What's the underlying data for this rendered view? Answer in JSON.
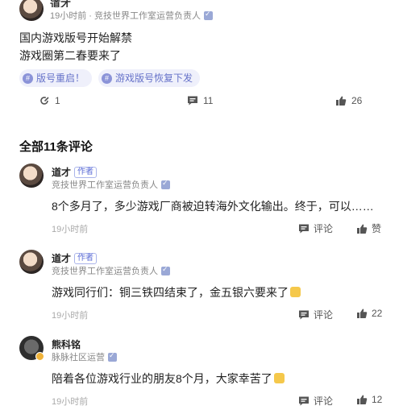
{
  "post": {
    "author": "道才",
    "meta": "19小时前 · 竞技世界工作室运营负责人",
    "lines": [
      "国内游戏版号开始解禁",
      "游戏圈第二春要来了"
    ],
    "tags": [
      "版号重启！",
      "游戏版号恢复下发"
    ],
    "actions": {
      "repost": "1",
      "comments": "11",
      "likes": "26"
    }
  },
  "comments_section": {
    "title": "全部11条评论",
    "comments": [
      {
        "name": "道才",
        "author_tag": "作者",
        "role": "竞技世界工作室运营负责人",
        "text": "8个多月了，多少游戏厂商被迫转海外文化输出。终于，可以……",
        "time": "19小时前",
        "reply": "评论",
        "like": "赞"
      },
      {
        "name": "道才",
        "author_tag": "作者",
        "role": "竞技世界工作室运营负责人",
        "text": "游戏同行们：铜三铁四结束了，金五银六要来了",
        "time": "19小时前",
        "reply": "评论",
        "like": "22"
      },
      {
        "name": "熊科铭",
        "author_tag": "",
        "role": "脉脉社区运营",
        "text": "陪着各位游戏行业的朋友8个月，大家幸苦了",
        "time": "19小时前",
        "reply": "评论",
        "like": "12"
      }
    ]
  },
  "colors": {
    "accent": "#5a6bd6",
    "tag_bg": "#eff0fb"
  }
}
